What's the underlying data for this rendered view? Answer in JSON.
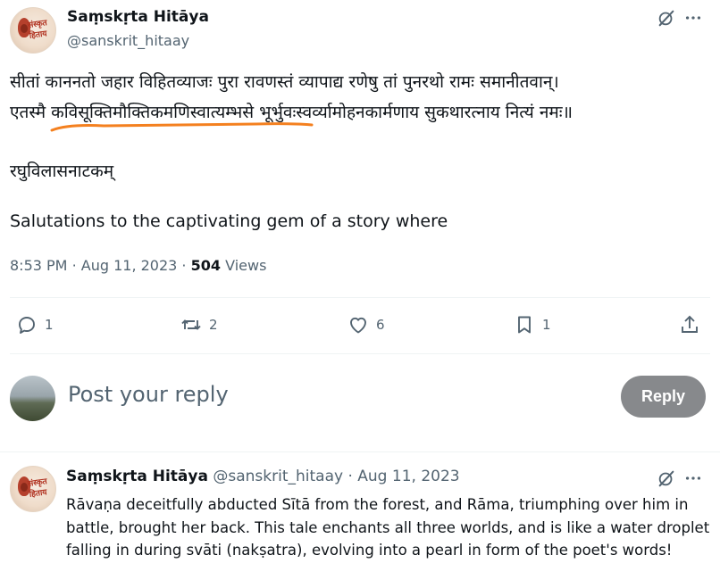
{
  "post": {
    "author_name": "Saṃskṛta Hitāya",
    "author_handle": "@sanskrit_hitaay",
    "avatar_logo_text": "संस्कृत हिताय",
    "lines": [
      "सीतां काननतो जहार विहितव्याजः पुरा रावणस्तं व्यापाद्य रणेषु तां पुनरथो रामः समानीतवान्।",
      "एतस्मै कविसूक्तिमौक्तिकमणिस्वात्यम्भसे भूर्भुवःस्वर्व्यामोहनकार्मणाय सुकथारत्नाय नित्यं नमः॥",
      "रघुविलासनाटकम्",
      "Salutations to the captivating gem of a story where"
    ],
    "time": "8:53 PM",
    "date": "Aug 11, 2023",
    "views_count": "504",
    "views_label": "Views",
    "separator": "·",
    "highlight_color": "#f4801f"
  },
  "actions": {
    "reply_count": "1",
    "retweet_count": "2",
    "like_count": "6",
    "bookmark_count": "1"
  },
  "composer": {
    "placeholder": "Post your reply",
    "reply_button": "Reply"
  },
  "reply": {
    "author_name": "Saṃskṛta Hitāya",
    "author_handle": "@sanskrit_hitaay",
    "separator": "·",
    "date": "Aug 11, 2023",
    "text": "Rāvaṇa deceitfully abducted Sītā from the forest, and Rāma, triumphing over him in battle, brought her back. This tale enchants all three worlds, and is like a water droplet falling in during svāti (nakṣatra), evolving into a pearl in form of the poet's words!"
  },
  "icons": {
    "grok": "grok-icon",
    "more": "more-icon",
    "reply": "reply-icon",
    "retweet": "retweet-icon",
    "like": "heart-icon",
    "bookmark": "bookmark-icon",
    "share": "share-icon"
  }
}
